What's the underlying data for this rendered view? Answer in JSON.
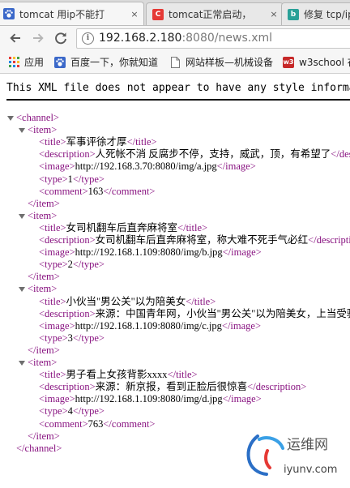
{
  "browser": {
    "tabs": [
      {
        "title": "tomcat 用ip不能打",
        "favicon": "paw-icon",
        "favicon_color": "#3b68c9",
        "active": true
      },
      {
        "title": "tomcat正常启动，",
        "favicon": "csdn-icon",
        "favicon_color": "#e53935",
        "active": false
      },
      {
        "title": "修复 tcp/ip",
        "favicon": "bing-icon",
        "favicon_color": "#2aa198",
        "active": false
      }
    ],
    "close_glyph": "×",
    "address": {
      "host": "192.168.2.180",
      "port": ":8080",
      "path": "/news.xml"
    },
    "bookmarks": [
      {
        "label": "应用",
        "icon": "apps-grid-icon"
      },
      {
        "label": "百度一下，你就知道",
        "icon": "paw-icon"
      },
      {
        "label": "网站样板—机械设备",
        "icon": "page-icon"
      },
      {
        "label": "w3school 在",
        "icon": "w3-icon",
        "icon_text": "w3"
      }
    ]
  },
  "page": {
    "notice": "This XML file does not appear to have any style information associated with it. The document tree is shown below."
  },
  "xml": {
    "root_tag": "channel",
    "item_tag": "item",
    "items": [
      {
        "title": "军事评徐才厚",
        "description": "人死帐不消 反腐步不停，支持，威武，顶，有希望了",
        "image": "http://192.168.3.70:8080/img/a.jpg",
        "type": "1",
        "comment": "163"
      },
      {
        "title": "女司机翻车后直奔麻将室",
        "description": "女司机翻车后直奔麻将室，称大难不死手气必红",
        "image": "http://192.168.1.109:8080/img/b.jpg",
        "type": "2"
      },
      {
        "title": "小伙当\"男公关\"以为陪美女",
        "description": "来源：中国青年网，小伙当\"男公关\"以为陪美女，上当受骗",
        "image": "http://192.168.1.109:8080/img/c.jpg",
        "type": "3"
      },
      {
        "title": "男子看上女孩背影xxxx",
        "description": "来源：新京报，看到正脸后很惊喜",
        "image": "http://192.168.1.109:8080/img/d.jpg",
        "type": "4",
        "comment": "763"
      }
    ]
  },
  "watermark": {
    "line1": "运维网",
    "line2": "iyunv.com"
  }
}
